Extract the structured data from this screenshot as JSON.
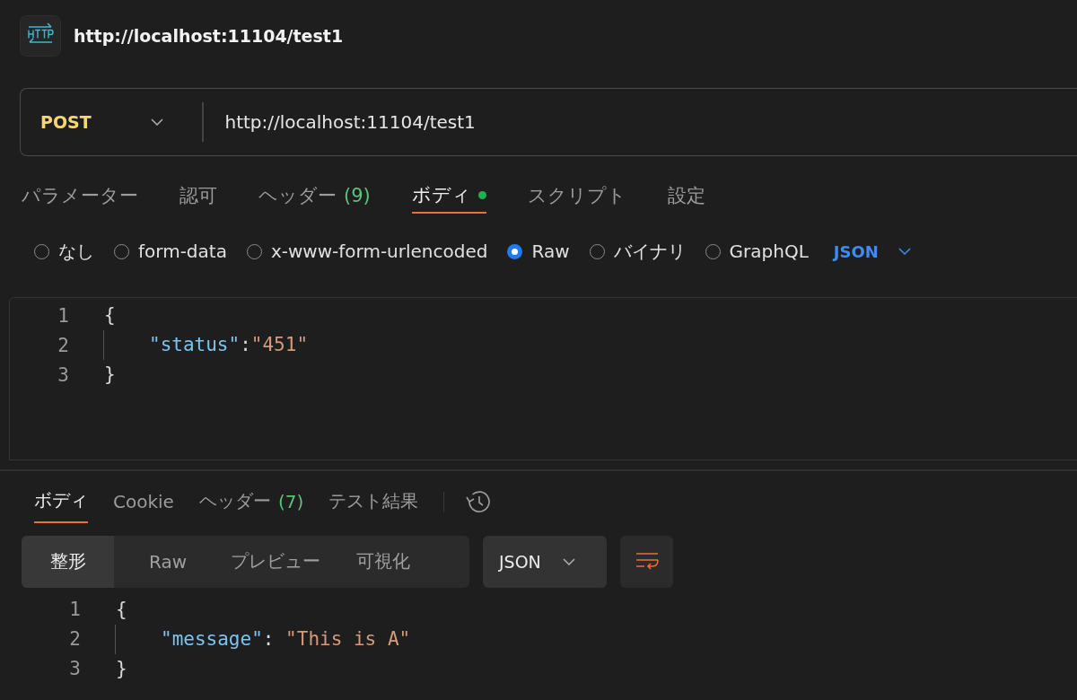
{
  "header": {
    "title": "http://localhost:11104/test1"
  },
  "request": {
    "method": "POST",
    "url": "http://localhost:11104/test1"
  },
  "request_tabs": [
    {
      "label": "パラメーター",
      "selected": false
    },
    {
      "label": "認可",
      "selected": false
    },
    {
      "label": "ヘッダー",
      "count": "(9)",
      "selected": false
    },
    {
      "label": "ボディ",
      "selected": true,
      "dot": true
    },
    {
      "label": "スクリプト",
      "selected": false
    },
    {
      "label": "設定",
      "selected": false
    }
  ],
  "body_types": [
    {
      "label": "なし",
      "selected": false
    },
    {
      "label": "form-data",
      "selected": false
    },
    {
      "label": "x-www-form-urlencoded",
      "selected": false
    },
    {
      "label": "Raw",
      "selected": true
    },
    {
      "label": "バイナリ",
      "selected": false
    },
    {
      "label": "GraphQL",
      "selected": false
    }
  ],
  "body_format": "JSON",
  "request_body": [
    {
      "number": "1",
      "guide": false,
      "tokens": [
        {
          "kind": "punct",
          "text": "{"
        }
      ]
    },
    {
      "number": "2",
      "guide": true,
      "tokens": [
        {
          "kind": "key",
          "text": "\"status\""
        },
        {
          "kind": "punct",
          "text": ":"
        },
        {
          "kind": "string",
          "text": "\"451\""
        }
      ]
    },
    {
      "number": "3",
      "guide": false,
      "tokens": [
        {
          "kind": "punct",
          "text": "}"
        }
      ]
    }
  ],
  "response_tabs": [
    {
      "label": "ボディ",
      "selected": true
    },
    {
      "label": "Cookie",
      "selected": false
    },
    {
      "label": "ヘッダー",
      "count": "(7)",
      "selected": false
    },
    {
      "label": "テスト結果",
      "selected": false
    }
  ],
  "view_modes": [
    {
      "label": "整形",
      "selected": true
    },
    {
      "label": "Raw",
      "selected": false
    },
    {
      "label": "プレビュー",
      "selected": false
    },
    {
      "label": "可視化",
      "selected": false
    }
  ],
  "response_format": "JSON",
  "response_body": [
    {
      "number": "1",
      "guide": false,
      "tokens": [
        {
          "kind": "punct",
          "text": "{"
        }
      ]
    },
    {
      "number": "2",
      "guide": true,
      "tokens": [
        {
          "kind": "key",
          "text": "\"message\""
        },
        {
          "kind": "punct",
          "text": ": "
        },
        {
          "kind": "string",
          "text": "\"This is A\""
        }
      ]
    },
    {
      "number": "3",
      "guide": false,
      "tokens": [
        {
          "kind": "punct",
          "text": "}"
        }
      ]
    }
  ]
}
